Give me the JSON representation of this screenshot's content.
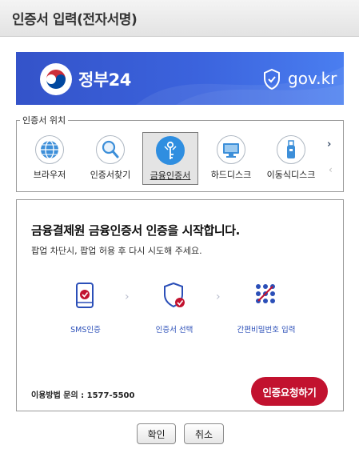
{
  "window": {
    "title": "인증서 입력(전자서명)"
  },
  "banner": {
    "brand": "정부24",
    "site": "gov.kr"
  },
  "location": {
    "legend": "인증서 위치",
    "items": [
      {
        "label": "브라우저",
        "icon": "globe-icon",
        "selected": false
      },
      {
        "label": "인증서찾기",
        "icon": "magnifier-icon",
        "selected": false
      },
      {
        "label": "금융인증서",
        "icon": "key-icon",
        "selected": true
      },
      {
        "label": "하드디스크",
        "icon": "monitor-icon",
        "selected": false
      },
      {
        "label": "이동식디스크",
        "icon": "usb-icon",
        "selected": false
      }
    ]
  },
  "panel": {
    "heading": "금융결제원 금융인증서 인증을 시작합니다.",
    "subtext": "팝업 차단시, 팝업 허용 후 다시 시도해 주세요.",
    "steps": [
      {
        "caption": "SMS인증",
        "icon": "phone-check-icon"
      },
      {
        "caption": "인증서 선택",
        "icon": "shield-check-icon"
      },
      {
        "caption": "간편비밀번호 입력",
        "icon": "pattern-icon"
      }
    ],
    "contact": "이용방법 문의 : 1577-5500",
    "request_button": "인증요청하기"
  },
  "buttons": {
    "ok": "확인",
    "cancel": "취소"
  },
  "colors": {
    "accent_blue": "#3b63dd",
    "request_red": "#c2122f",
    "step_text": "#2b4fb8"
  }
}
